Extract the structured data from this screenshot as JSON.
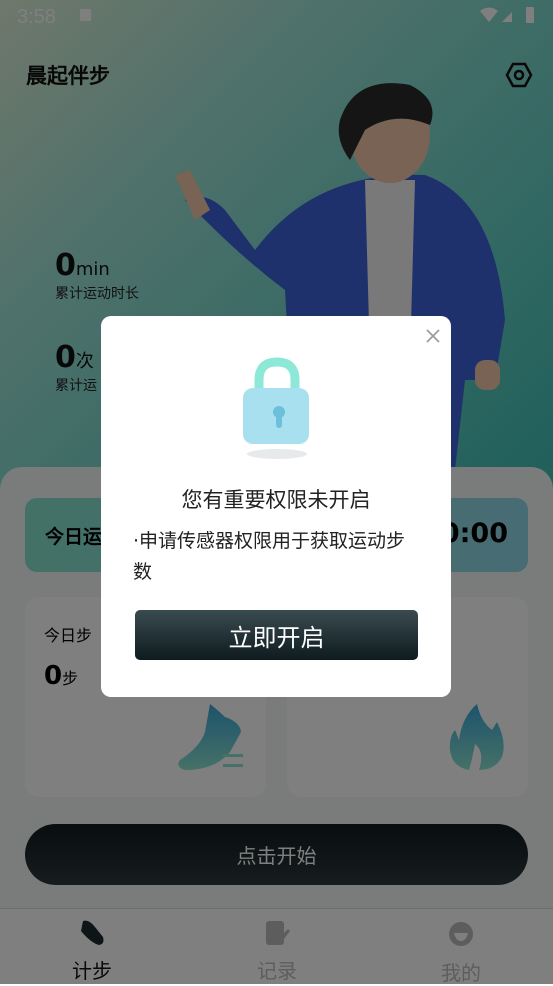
{
  "status_bar": {
    "time": "3:58"
  },
  "header": {
    "title": "晨起伴步",
    "settings_icon": "hexagon-settings-icon"
  },
  "stats": [
    {
      "value": "0",
      "unit": "min",
      "label": "累计运动时长"
    },
    {
      "value": "0",
      "unit": "次",
      "label": "累计运"
    }
  ],
  "banner": {
    "label": "今日运",
    "value": "0:00"
  },
  "cards": [
    {
      "label": "今日步",
      "value": "0",
      "unit": "步",
      "icon": "shoe-icon"
    },
    {
      "icon": "flame-icon"
    }
  ],
  "start_button": "点击开始",
  "nav": [
    {
      "label": "计步",
      "active": true
    },
    {
      "label": "记录"
    },
    {
      "label": "我的"
    }
  ],
  "dialog": {
    "title": "您有重要权限未开启",
    "body": "·申请传感器权限用于获取运动步数",
    "button": "立即开启"
  },
  "colors": {
    "accent": "#3cbdb3",
    "dark": "#111b1f"
  }
}
